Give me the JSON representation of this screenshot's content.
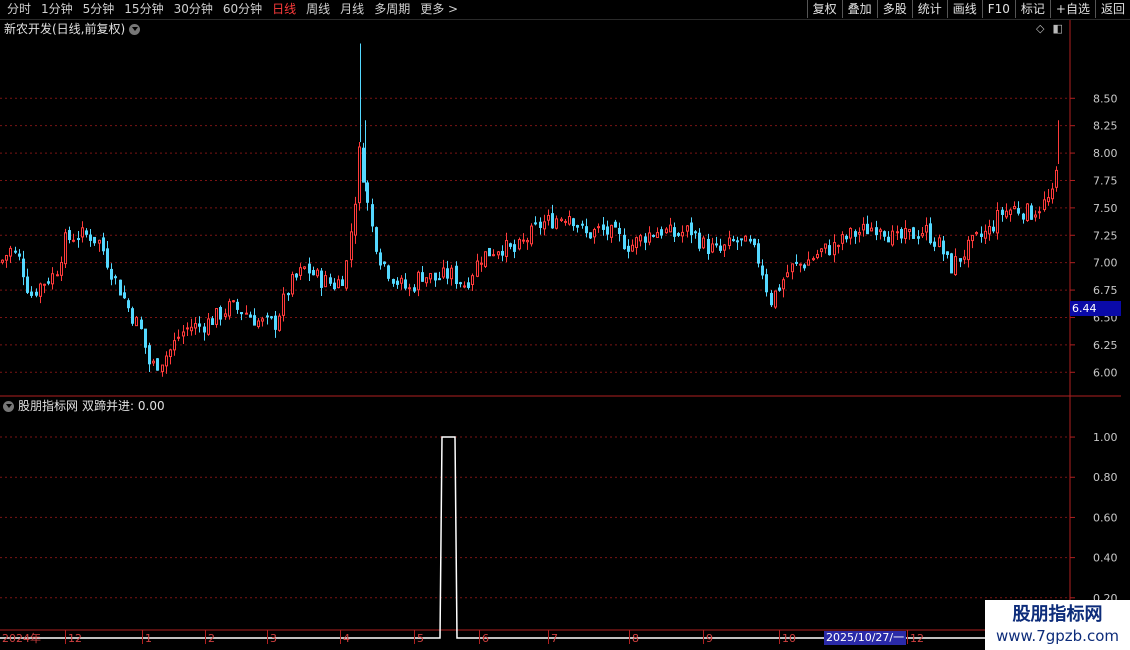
{
  "toolbar": {
    "periods": [
      "分时",
      "1分钟",
      "5分钟",
      "15分钟",
      "30分钟",
      "60分钟",
      "日线",
      "周线",
      "月线",
      "多周期",
      "更多 >"
    ],
    "active_index": 6,
    "buttons": [
      "复权",
      "叠加",
      "多股",
      "统计",
      "画线",
      "F10",
      "标记",
      "+自选",
      "返回"
    ]
  },
  "chart": {
    "title": "新农开发(日线,前复权)",
    "last_price": "6.44"
  },
  "indicator": {
    "name": "股朋指标网",
    "label": "双蹄并进: 0.00"
  },
  "time_axis": {
    "cursor_date": "2025/10/27/一"
  },
  "watermark": {
    "name": "股朋指标网",
    "url": "www.7gpzb.com"
  },
  "colors": {
    "up": "#ff3b3b",
    "down": "#54d8ff",
    "grid": "#7a1414",
    "axis": "#b02020",
    "line": "#ffffff"
  },
  "chart_data": [
    {
      "type": "candlestick",
      "title": "新农开发(日线,前复权)",
      "y_ticks": [
        6.0,
        6.25,
        6.5,
        6.75,
        7.0,
        7.25,
        7.5,
        7.75,
        8.0,
        8.25,
        8.5
      ],
      "ylim": [
        5.82,
        9.05
      ],
      "x_ticks": [
        "2024年",
        "12",
        "1",
        "2",
        "3",
        "4",
        "5",
        "6",
        "7",
        "8",
        "9",
        "10",
        "11",
        "12"
      ],
      "close_path": [
        [
          0,
          7.0
        ],
        [
          10,
          7.12
        ],
        [
          20,
          7.02
        ],
        [
          30,
          6.7
        ],
        [
          40,
          6.8
        ],
        [
          55,
          6.9
        ],
        [
          65,
          7.2
        ],
        [
          75,
          7.25
        ],
        [
          90,
          7.25
        ],
        [
          100,
          7.18
        ],
        [
          110,
          6.95
        ],
        [
          120,
          6.75
        ],
        [
          130,
          6.55
        ],
        [
          140,
          6.4
        ],
        [
          150,
          6.05
        ],
        [
          160,
          6.1
        ],
        [
          170,
          6.2
        ],
        [
          180,
          6.35
        ],
        [
          190,
          6.42
        ],
        [
          200,
          6.42
        ],
        [
          215,
          6.5
        ],
        [
          230,
          6.6
        ],
        [
          245,
          6.55
        ],
        [
          260,
          6.45
        ],
        [
          275,
          6.45
        ],
        [
          290,
          6.8
        ],
        [
          305,
          6.95
        ],
        [
          320,
          6.85
        ],
        [
          335,
          6.8
        ],
        [
          345,
          6.9
        ],
        [
          355,
          7.6
        ],
        [
          360,
          8.1
        ],
        [
          365,
          7.65
        ],
        [
          372,
          7.3
        ],
        [
          380,
          7.05
        ],
        [
          390,
          6.9
        ],
        [
          400,
          6.8
        ],
        [
          410,
          6.75
        ],
        [
          420,
          6.9
        ],
        [
          435,
          6.85
        ],
        [
          450,
          6.9
        ],
        [
          465,
          6.8
        ],
        [
          480,
          7.05
        ],
        [
          500,
          7.15
        ],
        [
          515,
          7.1
        ],
        [
          525,
          7.2
        ],
        [
          540,
          7.35
        ],
        [
          555,
          7.4
        ],
        [
          570,
          7.45
        ],
        [
          585,
          7.25
        ],
        [
          600,
          7.3
        ],
        [
          615,
          7.25
        ],
        [
          630,
          7.15
        ],
        [
          645,
          7.25
        ],
        [
          660,
          7.3
        ],
        [
          675,
          7.25
        ],
        [
          690,
          7.3
        ],
        [
          705,
          7.15
        ],
        [
          720,
          7.1
        ],
        [
          735,
          7.2
        ],
        [
          750,
          7.15
        ],
        [
          760,
          7.0
        ],
        [
          770,
          6.65
        ],
        [
          780,
          6.8
        ],
        [
          790,
          6.95
        ],
        [
          805,
          7.0
        ],
        [
          820,
          7.1
        ],
        [
          835,
          7.15
        ],
        [
          850,
          7.25
        ],
        [
          865,
          7.3
        ],
        [
          880,
          7.35
        ],
        [
          895,
          7.2
        ],
        [
          910,
          7.25
        ],
        [
          925,
          7.3
        ],
        [
          940,
          7.15
        ],
        [
          950,
          6.95
        ],
        [
          960,
          7.05
        ],
        [
          975,
          7.2
        ],
        [
          990,
          7.3
        ],
        [
          1000,
          7.45
        ],
        [
          1015,
          7.5
        ],
        [
          1030,
          7.45
        ],
        [
          1045,
          7.55
        ],
        [
          1052,
          7.6
        ],
        [
          1058,
          7.9
        ]
      ],
      "spikes": [
        [
          360,
          9.0
        ],
        [
          365,
          8.3
        ],
        [
          1058,
          8.3
        ]
      ]
    },
    {
      "type": "line",
      "title": "双蹄并进",
      "y_ticks": [
        0.2,
        0.4,
        0.6,
        0.8,
        1.0
      ],
      "ylim": [
        0,
        1.05
      ],
      "points": [
        [
          0,
          0
        ],
        [
          440,
          0
        ],
        [
          442,
          1
        ],
        [
          455,
          1
        ],
        [
          457,
          0
        ],
        [
          1070,
          0
        ]
      ]
    }
  ]
}
